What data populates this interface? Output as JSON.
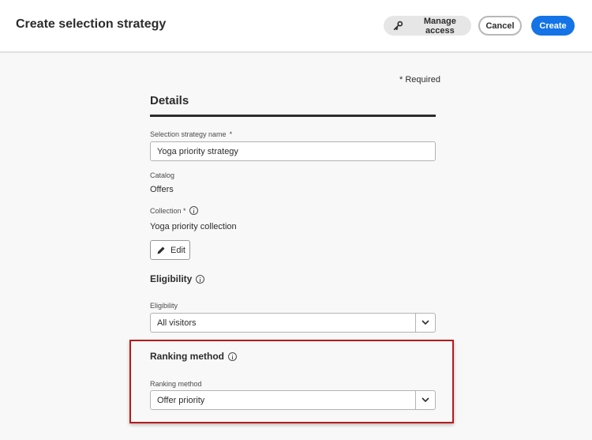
{
  "header": {
    "title": "Create selection strategy",
    "manage_access_label": "Manage access",
    "cancel_label": "Cancel",
    "create_label": "Create"
  },
  "form": {
    "required_note": "* Required",
    "details_title": "Details",
    "name_label": "Selection strategy name",
    "name_required_marker": "*",
    "name_value": "Yoga priority strategy",
    "catalog_label": "Catalog",
    "catalog_value": "Offers",
    "collection_label": "Collection *",
    "collection_value": "Yoga priority collection",
    "edit_label": "Edit",
    "eligibility_heading": "Eligibility",
    "eligibility_label": "Eligibility",
    "eligibility_value": "All visitors",
    "ranking_heading": "Ranking method",
    "ranking_label": "Ranking method",
    "ranking_value": "Offer priority"
  },
  "colors": {
    "accent": "#1473e6",
    "highlight": "#b51c1c"
  },
  "icons": {
    "manage_access": "key-icon",
    "edit": "pencil-icon",
    "info": "info-icon",
    "dropdown": "chevron-down-icon"
  }
}
